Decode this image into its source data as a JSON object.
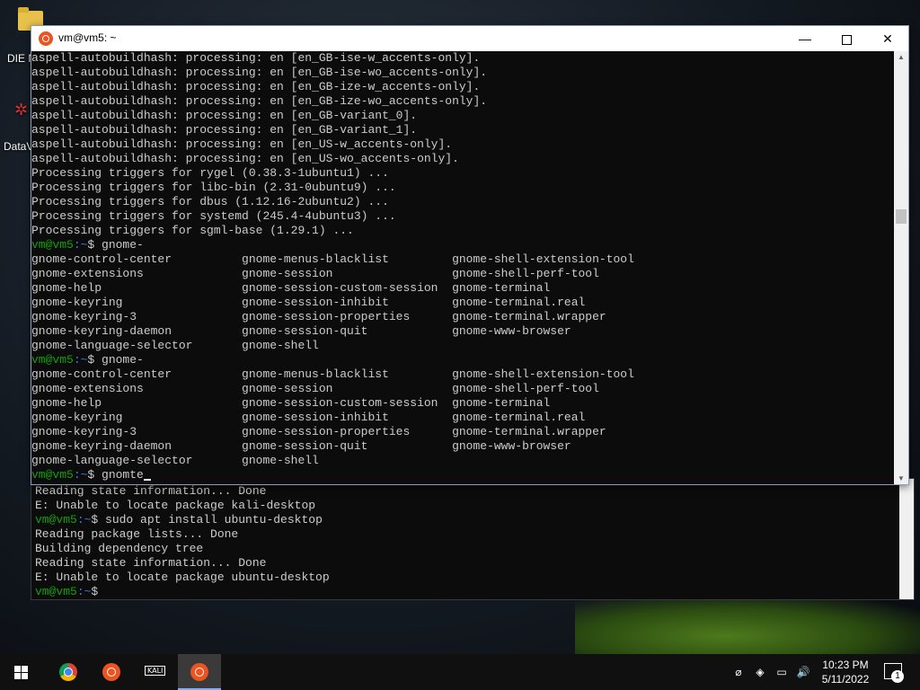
{
  "desktop": {
    "icons": [
      {
        "label": "DIE N",
        "icon": "folder-icon"
      },
      {
        "label": "DataV",
        "icon": "app-shortcut-icon"
      }
    ]
  },
  "window": {
    "title": "vm@vm5: ~",
    "minimize": "—",
    "close": "✕"
  },
  "terminal": {
    "prompt_user": "vm@vm5",
    "prompt_path": ":~",
    "prompt_symbol": "$",
    "lines": [
      {
        "type": "text",
        "text": "aspell-autobuildhash: processing: en [en_GB-ise-w_accents-only]."
      },
      {
        "type": "text",
        "text": "aspell-autobuildhash: processing: en [en_GB-ise-wo_accents-only]."
      },
      {
        "type": "text",
        "text": "aspell-autobuildhash: processing: en [en_GB-ize-w_accents-only]."
      },
      {
        "type": "text",
        "text": "aspell-autobuildhash: processing: en [en_GB-ize-wo_accents-only]."
      },
      {
        "type": "text",
        "text": "aspell-autobuildhash: processing: en [en_GB-variant_0]."
      },
      {
        "type": "text",
        "text": "aspell-autobuildhash: processing: en [en_GB-variant_1]."
      },
      {
        "type": "text",
        "text": "aspell-autobuildhash: processing: en [en_US-w_accents-only]."
      },
      {
        "type": "text",
        "text": "aspell-autobuildhash: processing: en [en_US-wo_accents-only]."
      },
      {
        "type": "text",
        "text": "Processing triggers for rygel (0.38.3-1ubuntu1) ..."
      },
      {
        "type": "text",
        "text": "Processing triggers for libc-bin (2.31-0ubuntu9) ..."
      },
      {
        "type": "text",
        "text": "Processing triggers for dbus (1.12.16-2ubuntu2) ..."
      },
      {
        "type": "text",
        "text": "Processing triggers for systemd (245.4-4ubuntu3) ..."
      },
      {
        "type": "text",
        "text": "Processing triggers for sgml-base (1.29.1) ..."
      },
      {
        "type": "prompt",
        "cmd": " gnome-"
      },
      {
        "type": "text",
        "text": "gnome-control-center          gnome-menus-blacklist         gnome-shell-extension-tool"
      },
      {
        "type": "text",
        "text": "gnome-extensions              gnome-session                 gnome-shell-perf-tool"
      },
      {
        "type": "text",
        "text": "gnome-help                    gnome-session-custom-session  gnome-terminal"
      },
      {
        "type": "text",
        "text": "gnome-keyring                 gnome-session-inhibit         gnome-terminal.real"
      },
      {
        "type": "text",
        "text": "gnome-keyring-3               gnome-session-properties      gnome-terminal.wrapper"
      },
      {
        "type": "text",
        "text": "gnome-keyring-daemon          gnome-session-quit            gnome-www-browser"
      },
      {
        "type": "text",
        "text": "gnome-language-selector       gnome-shell"
      },
      {
        "type": "prompt",
        "cmd": " gnome-"
      },
      {
        "type": "text",
        "text": "gnome-control-center          gnome-menus-blacklist         gnome-shell-extension-tool"
      },
      {
        "type": "text",
        "text": "gnome-extensions              gnome-session                 gnome-shell-perf-tool"
      },
      {
        "type": "text",
        "text": "gnome-help                    gnome-session-custom-session  gnome-terminal"
      },
      {
        "type": "text",
        "text": "gnome-keyring                 gnome-session-inhibit         gnome-terminal.real"
      },
      {
        "type": "text",
        "text": "gnome-keyring-3               gnome-session-properties      gnome-terminal.wrapper"
      },
      {
        "type": "text",
        "text": "gnome-keyring-daemon          gnome-session-quit            gnome-www-browser"
      },
      {
        "type": "text",
        "text": "gnome-language-selector       gnome-shell"
      },
      {
        "type": "prompt",
        "cmd": " gnomte",
        "cursor": true
      }
    ]
  },
  "back_terminal": {
    "lines": [
      {
        "type": "text",
        "text": "Reading state information... Done"
      },
      {
        "type": "text",
        "text": "E: Unable to locate package kali-desktop"
      },
      {
        "type": "prompt",
        "cmd": " sudo apt install ubuntu-desktop"
      },
      {
        "type": "text",
        "text": "Reading package lists... Done"
      },
      {
        "type": "text",
        "text": "Building dependency tree"
      },
      {
        "type": "text",
        "text": "Reading state information... Done"
      },
      {
        "type": "text",
        "text": "E: Unable to locate package ubuntu-desktop"
      },
      {
        "type": "prompt",
        "cmd": ""
      }
    ]
  },
  "taskbar": {
    "kali_label": "KALI",
    "time": "10:23 PM",
    "date": "5/11/2022",
    "notification_count": "1"
  }
}
